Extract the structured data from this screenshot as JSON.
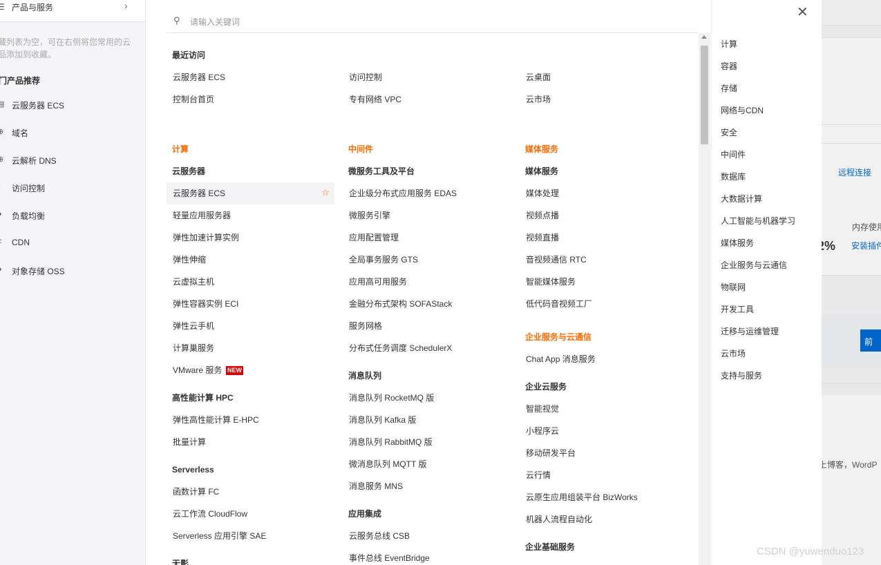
{
  "sidebar": {
    "top_label": "产品与服务",
    "empty_line1": "藏列表为空，可在右侧将您常用的云",
    "empty_line2": "品添加到收藏。",
    "hot_title": "门产品推荐",
    "items": [
      {
        "icon": "server-icon",
        "label": "云服务器 ECS"
      },
      {
        "icon": "globe-icon",
        "label": "域名"
      },
      {
        "icon": "dns-icon",
        "label": "云解析 DNS"
      },
      {
        "icon": "key-icon",
        "label": "访问控制"
      },
      {
        "icon": "balance-icon",
        "label": "负载均衡"
      },
      {
        "icon": "share-icon",
        "label": "CDN"
      },
      {
        "icon": "storage-icon",
        "label": "对象存储 OSS"
      }
    ]
  },
  "search": {
    "placeholder": "请输入关键词"
  },
  "recent": {
    "title": "最近访问",
    "items": [
      "云服务器 ECS",
      "访问控制",
      "云桌面",
      "控制台首页",
      "专有网络 VPC",
      "云市场"
    ]
  },
  "col1": {
    "category": "计算",
    "g1_title": "云服务器",
    "g1_items": [
      "云服务器 ECS",
      "轻量应用服务器",
      "弹性加速计算实例",
      "弹性伸缩",
      "云虚拟主机",
      "弹性容器实例 ECI",
      "弹性云手机",
      "计算巢服务",
      "VMware 服务"
    ],
    "new_badge": "NEW",
    "g2_title": "高性能计算 HPC",
    "g2_items": [
      "弹性高性能计算 E-HPC",
      "批量计算"
    ],
    "g3_title": "Serverless",
    "g3_items": [
      "函数计算 FC",
      "云工作流 CloudFlow",
      "Serverless 应用引擎 SAE"
    ],
    "g4_title": "无影"
  },
  "col2": {
    "category": "中间件",
    "g1_title": "微服务工具及平台",
    "g1_items": [
      "企业级分布式应用服务 EDAS",
      "微服务引擎",
      "应用配置管理",
      "全局事务服务 GTS",
      "应用高可用服务",
      "金融分布式架构 SOFAStack",
      "服务网格",
      "分布式任务调度 SchedulerX"
    ],
    "g2_title": "消息队列",
    "g2_items": [
      "消息队列 RocketMQ 版",
      "消息队列 Kafka 版",
      "消息队列 RabbitMQ 版",
      "微消息队列 MQTT 版",
      "消息服务 MNS"
    ],
    "g3_title": "应用集成",
    "g3_items": [
      "云服务总线 CSB",
      "事件总线 EventBridge"
    ]
  },
  "col3": {
    "category": "媒体服务",
    "g1_title": "媒体服务",
    "g1_items": [
      "媒体处理",
      "视频点播",
      "视频直播",
      "音视频通信 RTC",
      "智能媒体服务",
      "低代码音视频工厂"
    ],
    "category2": "企业服务与云通信",
    "g2_items": [
      "Chat App 消息服务"
    ],
    "g3_title": "企业云服务",
    "g3_items": [
      "智能视觉",
      "小程序云",
      "移动研发平台",
      "云行情",
      "云原生应用组装平台 BizWorks",
      "机器人流程自动化"
    ],
    "g4_title": "企业基础服务"
  },
  "right_nav": {
    "items": [
      "计算",
      "容器",
      "存储",
      "网络与CDN",
      "安全",
      "中间件",
      "数据库",
      "大数据计算",
      "人工智能与机器学习",
      "媒体服务",
      "企业服务与云通信",
      "物联网",
      "开发工具",
      "迁移与运维管理",
      "云市场",
      "支持与服务"
    ]
  },
  "bg_page": {
    "remote_link": "远程连接",
    "col_a": " ",
    "mem_label": "内存使用",
    "percent": "2%",
    "install_link": "安装插件",
    "btn_label": "前",
    "blog_text": "上博客，WordP"
  },
  "watermark": "CSDN @yuwenduo123",
  "colors": {
    "accent": "#ff6a00",
    "link": "#0064c8",
    "badge": "#dd0000"
  }
}
